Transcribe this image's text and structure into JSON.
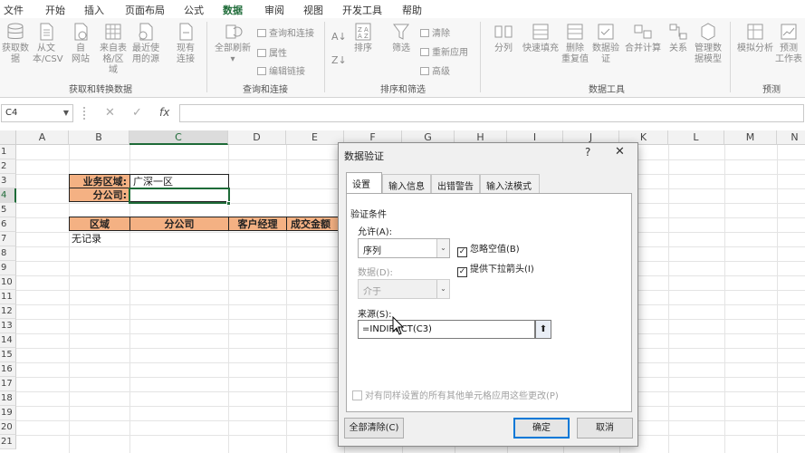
{
  "menu": {
    "tabs": [
      "文件",
      "开始",
      "插入",
      "页面布局",
      "公式",
      "数据",
      "审阅",
      "视图",
      "开发工具",
      "帮助"
    ],
    "active": "数据"
  },
  "ribbon": {
    "get_transform": {
      "buttons": [
        {
          "line1": "获取数",
          "line2": "据"
        },
        {
          "line1": "从文",
          "line2": "本/CSV"
        },
        {
          "line1": "自",
          "line2": "网站"
        },
        {
          "line1": "来自表",
          "line2": "格/区域"
        },
        {
          "line1": "最近使",
          "line2": "用的源"
        },
        {
          "line1": "现有",
          "line2": "连接"
        }
      ],
      "label": "获取和转换数据"
    },
    "queries": {
      "refresh": {
        "line1": "全部刷新",
        "line2": ""
      },
      "small": [
        "查询和连接",
        "属性",
        "编辑链接"
      ],
      "label": "查询和连接"
    },
    "sort_filter": {
      "sort": "排序",
      "filter": "筛选",
      "small": [
        "清除",
        "重新应用",
        "高级"
      ],
      "label": "排序和筛选"
    },
    "data_tools": {
      "buttons": [
        {
          "line1": "分列",
          "line2": ""
        },
        {
          "line1": "快速填充",
          "line2": ""
        },
        {
          "line1": "删除",
          "line2": "重复值"
        },
        {
          "line1": "数据验",
          "line2": "证"
        },
        {
          "line1": "合并计算",
          "line2": ""
        },
        {
          "line1": "关系",
          "line2": ""
        },
        {
          "line1": "管理数",
          "line2": "据模型"
        }
      ],
      "label": "数据工具"
    },
    "forecast": {
      "buttons": [
        {
          "line1": "模拟分析",
          "line2": ""
        },
        {
          "line1": "预测",
          "line2": "工作表"
        }
      ],
      "label": "预测"
    }
  },
  "formula_bar": {
    "name_box": "C4",
    "cancel_glyph": "✕",
    "enter_glyph": "✓",
    "fx_glyph": "fx",
    "content": ""
  },
  "sheet": {
    "columns": [
      "A",
      "B",
      "C",
      "D",
      "E",
      "F",
      "G",
      "H",
      "I",
      "J",
      "K",
      "L",
      "M",
      "N"
    ],
    "selected_col": "C",
    "rows": [
      "1",
      "2",
      "3",
      "4",
      "5",
      "6",
      "7",
      "8",
      "9",
      "10",
      "11",
      "12",
      "13",
      "14",
      "15",
      "16",
      "17",
      "18",
      "19",
      "20",
      "21"
    ],
    "selected_row": "4",
    "b3": "业务区域:",
    "c3": "广深一区",
    "b4": "分公司:",
    "c4": "",
    "headers": [
      "区域",
      "分公司",
      "客户经理",
      "成交金额"
    ],
    "b7": "无记录"
  },
  "dialog": {
    "title": "数据验证",
    "help": "?",
    "close": "✕",
    "tabs": [
      "设置",
      "输入信息",
      "出错警告",
      "输入法模式"
    ],
    "active_tab": "设置",
    "section": "验证条件",
    "allow_label": "允许(A):",
    "allow_value": "序列",
    "ignore_blank": "忽略空值(B)",
    "dropdown": "提供下拉箭头(I)",
    "data_label": "数据(D):",
    "data_value": "介于",
    "source_label": "来源(S):",
    "source_value": "=INDIRECT(C3)",
    "apply_all": "对有同样设置的所有其他单元格应用这些更改(P)",
    "clear_all": "全部清除(C)",
    "ok": "确定",
    "cancel": "取消",
    "check_glyph": "✓",
    "arrow_glyph": "⌄",
    "collapse_glyph": "🠉"
  },
  "colors": {
    "excel_green": "#1e6b38",
    "label_fill": "#f4b183",
    "focus_blue": "#0078d7"
  }
}
